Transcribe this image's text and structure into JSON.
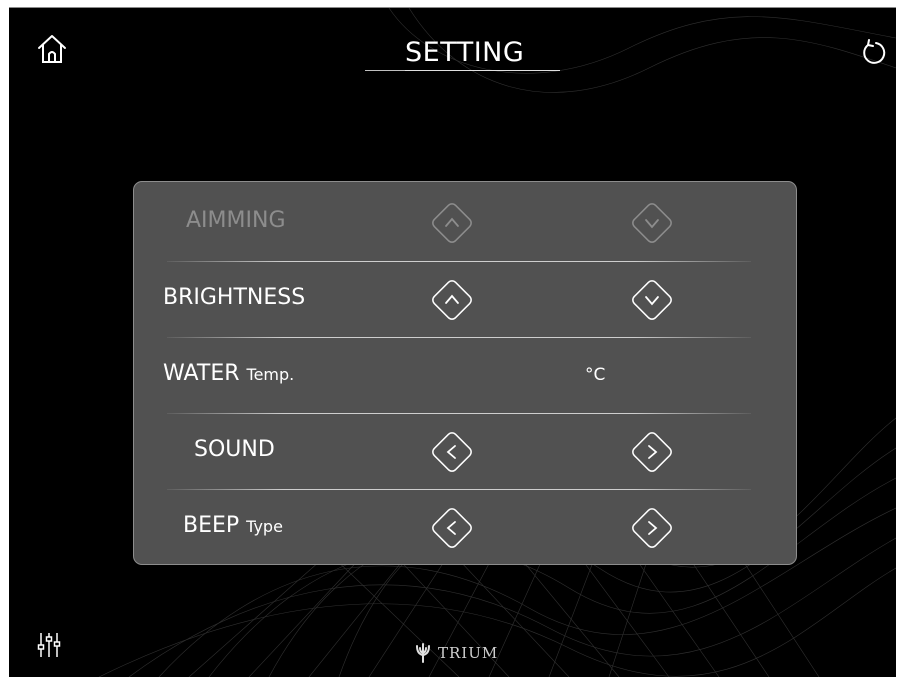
{
  "header": {
    "title": "SETTING"
  },
  "rows": [
    {
      "label": "AIMMING",
      "suffix": "",
      "left": "up",
      "right": "down",
      "enabled": false
    },
    {
      "label": "BRIGHTNESS",
      "suffix": "",
      "left": "up",
      "right": "down",
      "enabled": true
    },
    {
      "label": "WATER",
      "suffix": "Temp.",
      "unit": "°C"
    },
    {
      "label": "SOUND",
      "suffix": "",
      "left": "prev",
      "right": "next",
      "enabled": true
    },
    {
      "label": "BEEP",
      "suffix": "Type",
      "left": "prev",
      "right": "next",
      "enabled": true
    }
  ],
  "footer": {
    "brand": "TRIUM"
  },
  "icons": {
    "home": "home-icon",
    "refresh": "refresh-icon",
    "settings": "equalizer-icon",
    "brand": "trident-icon"
  },
  "colors": {
    "background": "#000000",
    "panel": "#515151",
    "text": "#ffffff",
    "disabled_text": "#8d8d8d"
  }
}
